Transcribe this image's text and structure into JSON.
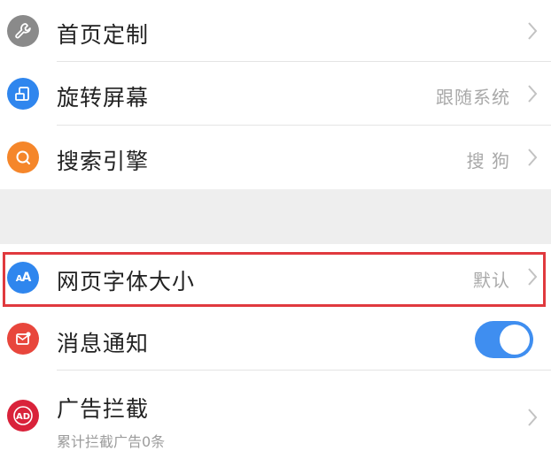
{
  "colors": {
    "highlight": "#e0393e",
    "toggle_on": "#3f8ef0",
    "icon_gray": "#8a8a8a",
    "icon_blue": "#2f86ee",
    "icon_orange": "#f5862a",
    "icon_red": "#e8463c",
    "icon_crimson": "#d9223a"
  },
  "settings": {
    "homepage_custom": {
      "label": "首页定制",
      "icon": "wrench-icon"
    },
    "rotate_screen": {
      "label": "旋转屏幕",
      "value": "跟随系统",
      "icon": "rotate-screen-icon"
    },
    "search_engine": {
      "label": "搜索引擎",
      "value": "搜 狗",
      "icon": "search-icon"
    },
    "font_size": {
      "label": "网页字体大小",
      "value": "默认",
      "icon_text": "AA",
      "icon": "font-size-icon"
    },
    "notifications": {
      "label": "消息通知",
      "enabled": true,
      "icon": "message-icon"
    },
    "ad_block": {
      "label": "广告拦截",
      "subtitle": "累计拦截广告0条",
      "icon_text": "AD",
      "icon": "ad-block-icon"
    }
  }
}
